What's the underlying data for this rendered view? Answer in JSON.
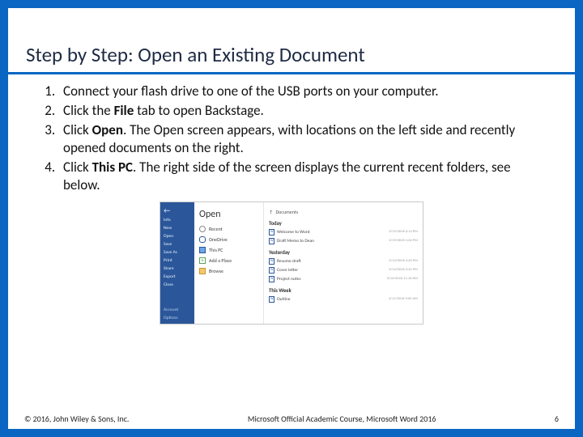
{
  "title": "Step by Step: Open an Existing Document",
  "steps": [
    {
      "pre": "Connect your flash drive to one of the USB ports on your computer."
    },
    {
      "pre": "Click the ",
      "bold": "File",
      "post": " tab to open Backstage."
    },
    {
      "pre": "Click ",
      "bold": "Open",
      "post": ". The Open screen appears, with locations on the left side and recently opened documents on the right."
    },
    {
      "pre": "Click ",
      "bold": "This PC",
      "post": ". The right side of the screen displays the current recent folders, see below."
    }
  ],
  "screenshot": {
    "rail": [
      "Info",
      "New",
      "Open",
      "Save",
      "Save As",
      "Print",
      "Share",
      "Export",
      "Close"
    ],
    "rail_bottom": [
      "Account",
      "Options"
    ],
    "mid_heading": "Open",
    "mid_items": [
      {
        "icon": "clock",
        "label": "Recent"
      },
      {
        "icon": "cloud",
        "label": "OneDrive"
      },
      {
        "icon": "pc",
        "label": "This PC"
      },
      {
        "icon": "plus",
        "label": "Add a Place"
      },
      {
        "icon": "folder",
        "label": "Browse"
      }
    ],
    "right": {
      "path_icon": "↑",
      "path": "Documents",
      "groups": [
        {
          "label": "Today",
          "docs": [
            {
              "name": "Welcome to Word",
              "meta": "3/15/2016 2:14 PM"
            },
            {
              "name": "Draft Memo to Dean",
              "meta": "3/15/2016 1:02 PM"
            }
          ]
        },
        {
          "label": "Yesterday",
          "docs": [
            {
              "name": "Resume draft",
              "meta": "3/14/2016 4:40 PM"
            },
            {
              "name": "Cover letter",
              "meta": "3/14/2016 3:21 PM"
            },
            {
              "name": "Project notes",
              "meta": "3/14/2016 11:10 AM"
            }
          ]
        },
        {
          "label": "This Week",
          "docs": [
            {
              "name": "Outline",
              "meta": "3/11/2016 9:05 AM"
            }
          ]
        }
      ]
    }
  },
  "footer": {
    "left": "© 2016, John Wiley & Sons, Inc.",
    "center": "Microsoft Official Academic Course, Microsoft Word 2016",
    "right": "6"
  }
}
